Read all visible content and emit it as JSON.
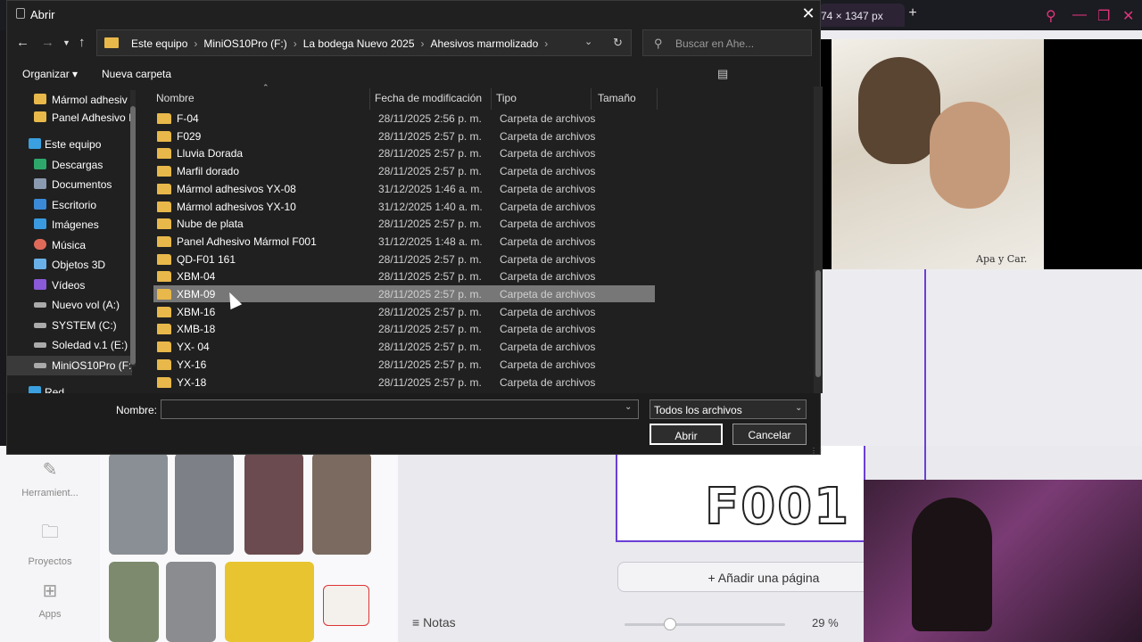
{
  "background": {
    "tab_label": "74 × 1347 px",
    "plus": "+",
    "rail": [
      {
        "label": "Herramient...",
        "icon": "tools-icon"
      },
      {
        "label": "Proyectos",
        "icon": "folder-icon"
      },
      {
        "label": "Apps",
        "icon": "apps-icon"
      }
    ],
    "canvas_text": "F001",
    "add_page": "+ Añadir una página",
    "notes": "Notas",
    "zoom": "29 %",
    "portrait_signature": "Apa y Car."
  },
  "dialog": {
    "title": "Abrir",
    "breadcrumbs": [
      "Este equipo",
      "MiniOS10Pro (F:)",
      "La bodega Nuevo 2025",
      "Ahesivos marmolizado"
    ],
    "search_placeholder": "Buscar en Ahe...",
    "toolbar": {
      "organize": "Organizar ▾",
      "new_folder": "Nueva carpeta"
    },
    "sidebar": [
      {
        "label": "Mármol adhesiv",
        "icon": "folder",
        "indent": 1
      },
      {
        "label": "Panel Adhesivo I",
        "icon": "folder",
        "indent": 1
      },
      {
        "label": "Este equipo",
        "icon": "pc",
        "indent": 0
      },
      {
        "label": "Descargas",
        "icon": "download",
        "indent": 1
      },
      {
        "label": "Documentos",
        "icon": "document",
        "indent": 1
      },
      {
        "label": "Escritorio",
        "icon": "desktop",
        "indent": 1
      },
      {
        "label": "Imágenes",
        "icon": "images",
        "indent": 1
      },
      {
        "label": "Música",
        "icon": "music",
        "indent": 1
      },
      {
        "label": "Objetos 3D",
        "icon": "3d",
        "indent": 1
      },
      {
        "label": "Vídeos",
        "icon": "video",
        "indent": 1
      },
      {
        "label": "Nuevo vol (A:)",
        "icon": "drive",
        "indent": 1
      },
      {
        "label": "SYSTEM (C:)",
        "icon": "drive",
        "indent": 1
      },
      {
        "label": "Soledad v.1 (E:)",
        "icon": "drive",
        "indent": 1
      },
      {
        "label": "MiniOS10Pro (F:)",
        "icon": "drive",
        "indent": 1,
        "active": true
      },
      {
        "label": "Red",
        "icon": "network",
        "indent": 0
      }
    ],
    "columns": [
      "Nombre",
      "Fecha de modificación",
      "Tipo",
      "Tamaño"
    ],
    "files": [
      {
        "name": "F-04",
        "date": "28/11/2025 2:56 p. m.",
        "type": "Carpeta de archivos"
      },
      {
        "name": "F029",
        "date": "28/11/2025 2:57 p. m.",
        "type": "Carpeta de archivos"
      },
      {
        "name": "Lluvia Dorada",
        "date": "28/11/2025 2:57 p. m.",
        "type": "Carpeta de archivos"
      },
      {
        "name": "Marfil dorado",
        "date": "28/11/2025 2:57 p. m.",
        "type": "Carpeta de archivos"
      },
      {
        "name": "Mármol adhesivos YX-08",
        "date": "31/12/2025 1:46 a. m.",
        "type": "Carpeta de archivos"
      },
      {
        "name": "Mármol adhesivos YX-10",
        "date": "31/12/2025 1:40 a. m.",
        "type": "Carpeta de archivos"
      },
      {
        "name": "Nube de plata",
        "date": "28/11/2025 2:57 p. m.",
        "type": "Carpeta de archivos"
      },
      {
        "name": "Panel Adhesivo Mármol F001",
        "date": "31/12/2025 1:48 a. m.",
        "type": "Carpeta de archivos"
      },
      {
        "name": "QD-F01 161",
        "date": "28/11/2025 2:57 p. m.",
        "type": "Carpeta de archivos"
      },
      {
        "name": "XBM-04",
        "date": "28/11/2025 2:57 p. m.",
        "type": "Carpeta de archivos"
      },
      {
        "name": "XBM-09",
        "date": "28/11/2025 2:57 p. m.",
        "type": "Carpeta de archivos",
        "selected": true
      },
      {
        "name": "XBM-16",
        "date": "28/11/2025 2:57 p. m.",
        "type": "Carpeta de archivos"
      },
      {
        "name": "XMB-18",
        "date": "28/11/2025 2:57 p. m.",
        "type": "Carpeta de archivos"
      },
      {
        "name": "YX- 04",
        "date": "28/11/2025 2:57 p. m.",
        "type": "Carpeta de archivos"
      },
      {
        "name": "YX-16",
        "date": "28/11/2025 2:57 p. m.",
        "type": "Carpeta de archivos"
      },
      {
        "name": "YX-18",
        "date": "28/11/2025 2:57 p. m.",
        "type": "Carpeta de archivos"
      }
    ],
    "bottom": {
      "name_label": "Nombre:",
      "name_value": "",
      "filter": "Todos los archivos",
      "open": "Abrir",
      "cancel": "Cancelar"
    }
  }
}
